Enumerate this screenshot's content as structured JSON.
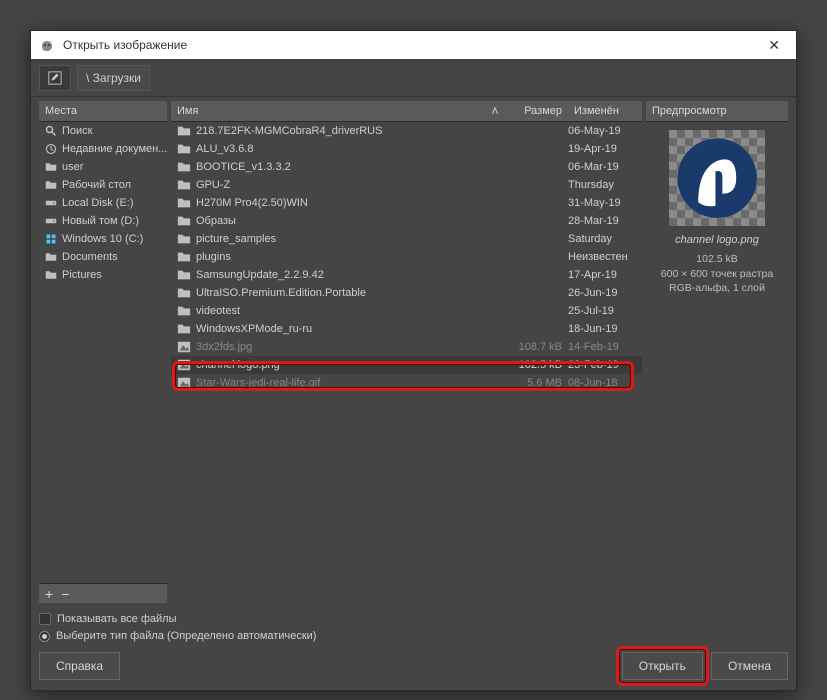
{
  "window": {
    "title": "Открыть изображение",
    "close": "✕"
  },
  "toolbar": {
    "edit_icon": "✎",
    "path": "\\ Загрузки"
  },
  "places_header": "Места",
  "places": [
    {
      "icon": "search",
      "label": "Поиск"
    },
    {
      "icon": "recent",
      "label": "Недавние докумен..."
    },
    {
      "icon": "folder",
      "label": "user"
    },
    {
      "icon": "folder",
      "label": "Рабочий стол"
    },
    {
      "icon": "disk",
      "label": "Local Disk (E:)"
    },
    {
      "icon": "disk",
      "label": "Новый том (D:)"
    },
    {
      "icon": "win",
      "label": "Windows 10 (C:)"
    },
    {
      "icon": "folder",
      "label": "Documents"
    },
    {
      "icon": "folder",
      "label": "Pictures"
    }
  ],
  "places_add": "+",
  "places_remove": "−",
  "file_head": {
    "name": "Имя",
    "size": "Размер",
    "date": "Изменён",
    "sort": "ᐱ"
  },
  "files": [
    {
      "t": "folder",
      "n": "218.7E2FK-MGMCobraR4_driverRUS",
      "s": "",
      "d": "06-May-19"
    },
    {
      "t": "folder",
      "n": "ALU_v3.6.8",
      "s": "",
      "d": "19-Apr-19"
    },
    {
      "t": "folder",
      "n": "BOOTICE_v1.3.3.2",
      "s": "",
      "d": "06-Mar-19"
    },
    {
      "t": "folder",
      "n": "GPU-Z",
      "s": "",
      "d": "Thursday"
    },
    {
      "t": "folder",
      "n": "H270M Pro4(2.50)WIN",
      "s": "",
      "d": "31-May-19"
    },
    {
      "t": "folder",
      "n": "Образы",
      "s": "",
      "d": "28-Mar-19"
    },
    {
      "t": "folder",
      "n": "picture_samples",
      "s": "",
      "d": "Saturday"
    },
    {
      "t": "folder",
      "n": "plugins",
      "s": "",
      "d": "Неизвестен"
    },
    {
      "t": "folder",
      "n": "SamsungUpdate_2.2.9.42",
      "s": "",
      "d": "17-Apr-19"
    },
    {
      "t": "folder",
      "n": "UltraISO.Premium.Edition.Portable",
      "s": "",
      "d": "26-Jun-19"
    },
    {
      "t": "folder",
      "n": "videotest",
      "s": "",
      "d": "25-Jul-19"
    },
    {
      "t": "folder",
      "n": "WindowsXPMode_ru-ru",
      "s": "",
      "d": "18-Jun-19"
    },
    {
      "t": "img",
      "n": "3dx2fds.jpg",
      "s": "108.7 kB",
      "d": "14-Feb-19",
      "obscured": true
    },
    {
      "t": "img",
      "n": "channel logo.png",
      "s": "102.5 kB",
      "d": "23-Feb-19",
      "selected": true
    },
    {
      "t": "img",
      "n": "Star-Wars-jedi-real-life.gif",
      "s": "5.6 MB",
      "d": "08-Jun-18",
      "obscured": true
    }
  ],
  "preview": {
    "header": "Предпросмотр",
    "name": "channel logo.png",
    "size": "102.5 kB",
    "dims": "600 × 600 точек растра",
    "mode": "RGB-альфа, 1 слой"
  },
  "opts": {
    "show_all": "Показывать все файлы",
    "auto_type": "Выберите тип файла (Определено автоматически)"
  },
  "buttons": {
    "help": "Справка",
    "open": "Открыть",
    "cancel": "Отмена"
  }
}
